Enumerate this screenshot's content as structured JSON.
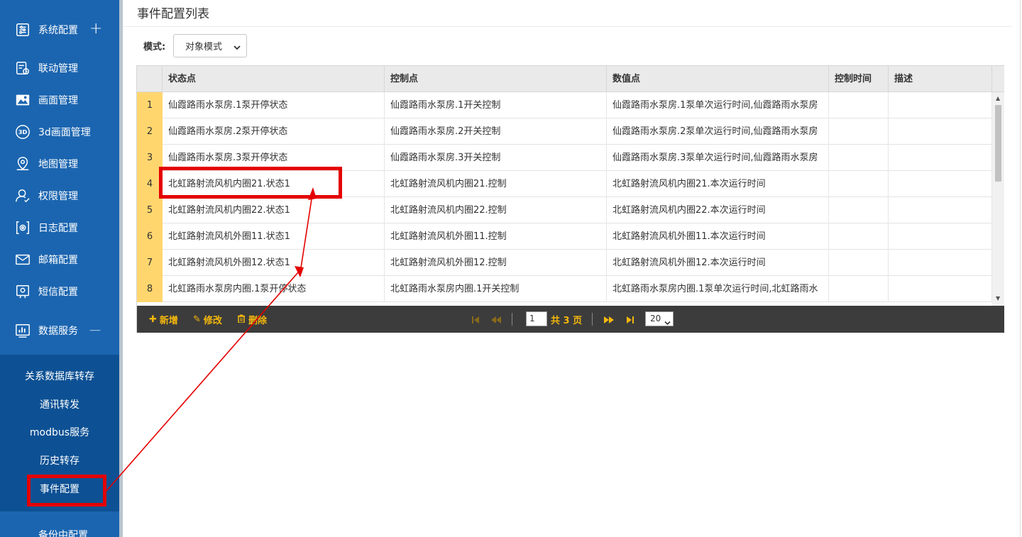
{
  "sidebar": {
    "items": [
      {
        "label": "系统配置",
        "icon": "system-config-icon",
        "toggle": "+"
      },
      {
        "label": "联动管理",
        "icon": "linkage-icon"
      },
      {
        "label": "画面管理",
        "icon": "picture-icon"
      },
      {
        "label": "3d画面管理",
        "icon": "3d-icon",
        "icon_text": "3D"
      },
      {
        "label": "地图管理",
        "icon": "map-pin-icon"
      },
      {
        "label": "权限管理",
        "icon": "user-permission-icon"
      },
      {
        "label": "日志配置",
        "icon": "log-config-icon"
      },
      {
        "label": "邮箱配置",
        "icon": "mail-icon"
      },
      {
        "label": "短信配置",
        "icon": "sms-icon"
      },
      {
        "label": "数据服务",
        "icon": "bar-chart-icon",
        "toggle": "—"
      }
    ],
    "submenu": [
      {
        "label": "关系数据库转存"
      },
      {
        "label": "通讯转发"
      },
      {
        "label": "modbus服务"
      },
      {
        "label": "历史转存"
      },
      {
        "label": "事件配置",
        "active": true
      }
    ],
    "partial_label": "备份中配置"
  },
  "page": {
    "title": "事件配置列表",
    "mode_label": "模式:",
    "mode_value": "对象模式"
  },
  "grid": {
    "columns": [
      "状态点",
      "控制点",
      "数值点",
      "控制时间",
      "描述"
    ],
    "rows": [
      {
        "num": "1",
        "status": "仙霞路雨水泵房.1泵开停状态",
        "control": "仙霞路雨水泵房.1开关控制",
        "value": "仙霞路雨水泵房.1泵单次运行时间,仙霞路雨水泵房",
        "time": "",
        "desc": ""
      },
      {
        "num": "2",
        "status": "仙霞路雨水泵房.2泵开停状态",
        "control": "仙霞路雨水泵房.2开关控制",
        "value": "仙霞路雨水泵房.2泵单次运行时间,仙霞路雨水泵房",
        "time": "",
        "desc": ""
      },
      {
        "num": "3",
        "status": "仙霞路雨水泵房.3泵开停状态",
        "control": "仙霞路雨水泵房.3开关控制",
        "value": "仙霞路雨水泵房.3泵单次运行时间,仙霞路雨水泵房",
        "time": "",
        "desc": ""
      },
      {
        "num": "4",
        "status": "北虹路射流风机内圈21.状态1",
        "control": "北虹路射流风机内圈21.控制",
        "value": "北虹路射流风机内圈21.本次运行时间",
        "time": "",
        "desc": ""
      },
      {
        "num": "5",
        "status": "北虹路射流风机内圈22.状态1",
        "control": "北虹路射流风机内圈22.控制",
        "value": "北虹路射流风机内圈22.本次运行时间",
        "time": "",
        "desc": ""
      },
      {
        "num": "6",
        "status": "北虹路射流风机外圈11.状态1",
        "control": "北虹路射流风机外圈11.控制",
        "value": "北虹路射流风机外圈11.本次运行时间",
        "time": "",
        "desc": ""
      },
      {
        "num": "7",
        "status": "北虹路射流风机外圈12.状态1",
        "control": "北虹路射流风机外圈12.控制",
        "value": "北虹路射流风机外圈12.本次运行时间",
        "time": "",
        "desc": ""
      },
      {
        "num": "8",
        "status": "北虹路雨水泵房内圈.1泵开停状态",
        "control": "北虹路雨水泵房内圈.1开关控制",
        "value": "北虹路雨水泵房内圈.1泵单次运行时间,北虹路雨水",
        "time": "",
        "desc": ""
      }
    ]
  },
  "toolbar": {
    "add": "新增",
    "edit": "修改",
    "delete": "删除"
  },
  "pager": {
    "current_page": "1",
    "total_text": "共 3 页",
    "page_size": "20"
  },
  "colors": {
    "sidebar_bg": "#1b65b0",
    "submenu_bg": "#0d5194",
    "row_number_bg": "#ffd66e",
    "toolbar_bg": "#3c3c3c",
    "toolbar_text": "#f5b80c",
    "annotation_red": "#e40000"
  }
}
